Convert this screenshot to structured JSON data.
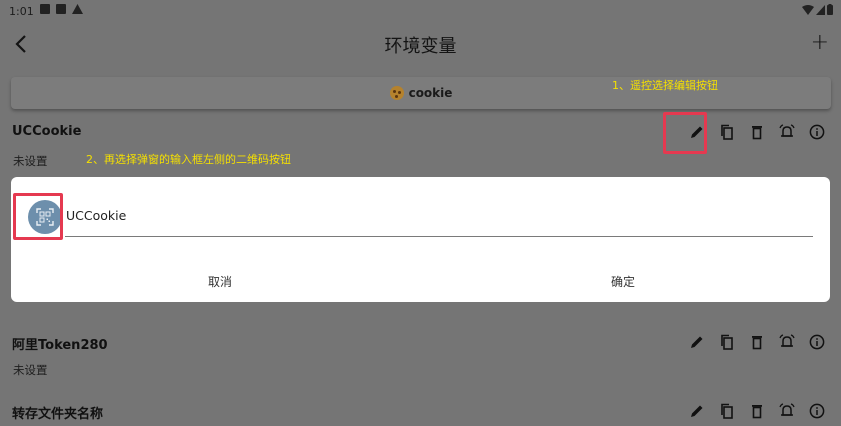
{
  "status_bar": {
    "time": "1:01"
  },
  "app_bar": {
    "title": "环境变量"
  },
  "tabs": {
    "active_label": "cookie"
  },
  "annotations": {
    "step1": "1、遥控选择编辑按钮",
    "step2": "2、再选择弹窗的输入框左侧的二维码按钮"
  },
  "env_rows": [
    {
      "name": "UCCookie",
      "value": "未设置"
    },
    {
      "name": "阿里Token280",
      "value": "未设置"
    },
    {
      "name": "转存文件夹名称",
      "value": ""
    }
  ],
  "dialog": {
    "input_value": "UCCookie",
    "cancel_label": "取消",
    "confirm_label": "确定"
  },
  "colors": {
    "annotation": "#f5e000",
    "highlight": "#e53950",
    "scrim": "#757575"
  },
  "icons": [
    "back-icon",
    "add-icon",
    "edit-icon",
    "copy-icon",
    "delete-icon",
    "alarm-icon",
    "info-icon",
    "qr-scan-icon"
  ]
}
